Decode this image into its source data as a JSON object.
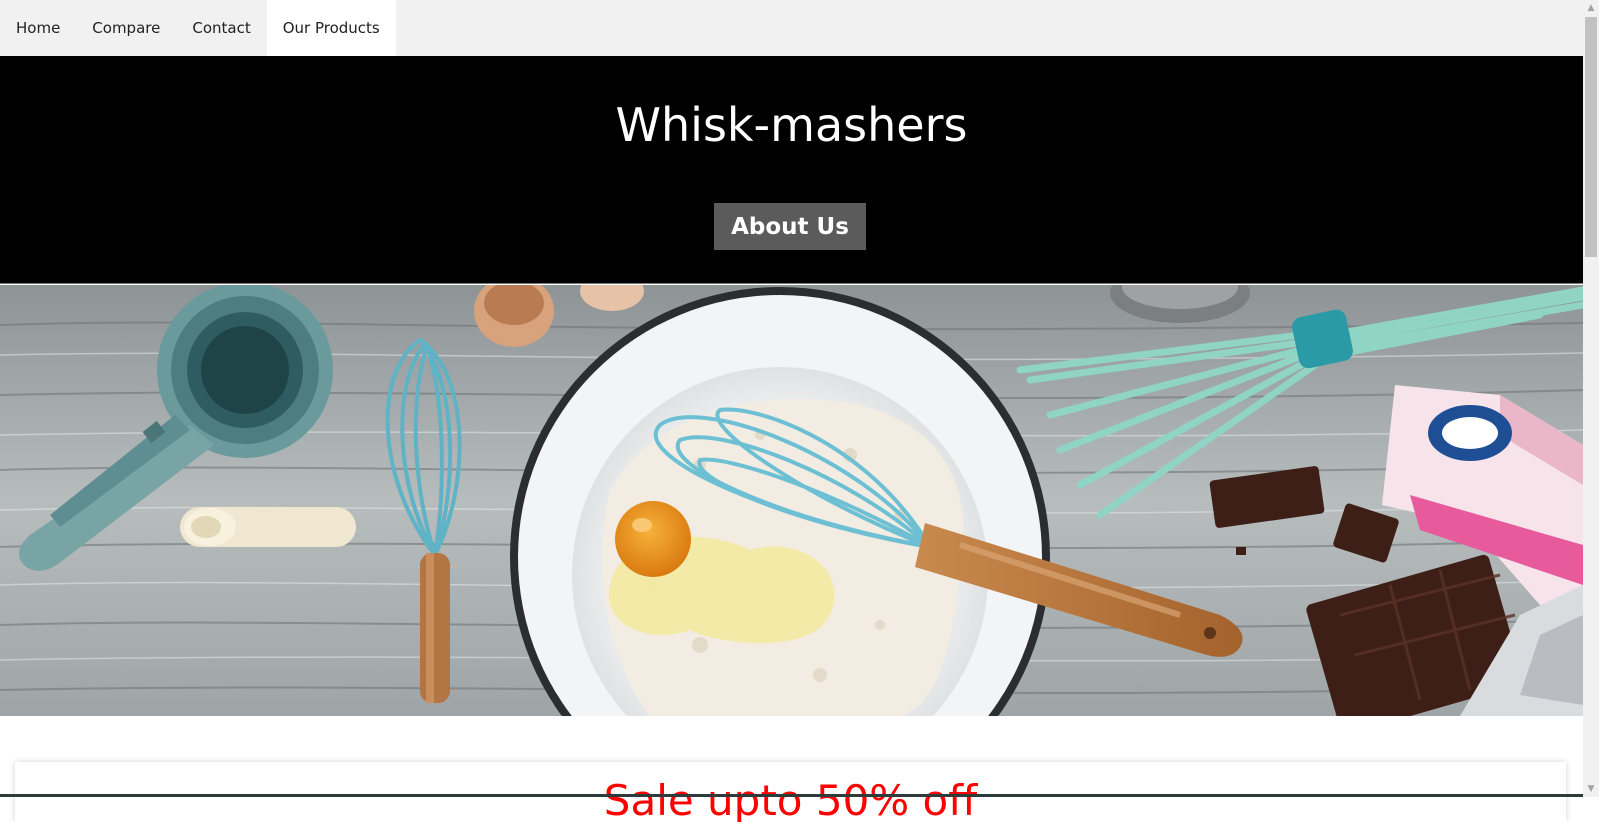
{
  "nav": {
    "items": [
      {
        "label": "Home",
        "active": false
      },
      {
        "label": "Compare",
        "active": false
      },
      {
        "label": "Contact",
        "active": false
      },
      {
        "label": "Our Products",
        "active": true
      }
    ]
  },
  "header": {
    "title": "Whisk-mashers",
    "about_label": "About Us"
  },
  "hero": {
    "alt": "baking-tools-hero-image"
  },
  "sale": {
    "text": "Sale upto 50% off"
  },
  "colors": {
    "header_bg": "#000000",
    "nav_bg": "#f1f1f1",
    "button_bg": "#5b5b5b",
    "sale_text": "#ff0000"
  },
  "icons": {
    "scroll_up": "scroll-up-arrow-icon",
    "scroll_down": "scroll-down-arrow-icon"
  }
}
